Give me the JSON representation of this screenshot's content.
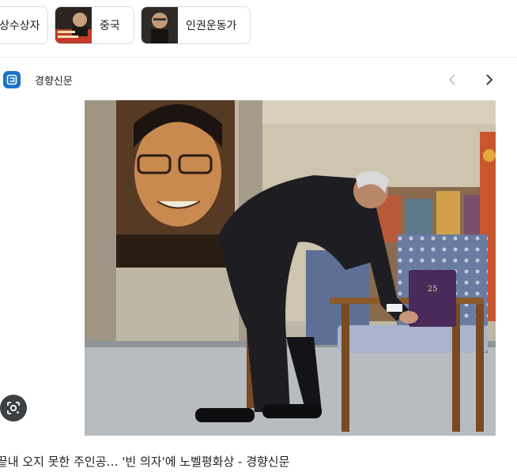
{
  "related_chips": [
    {
      "label": "상수상자"
    },
    {
      "label": "중국"
    },
    {
      "label": "인권운동가"
    }
  ],
  "source": {
    "name": "경향신문",
    "logo_color": "#1a73c8"
  },
  "nav": {
    "prev_icon": "chevron-left-icon",
    "next_icon": "chevron-right-icon"
  },
  "image": {
    "subject": "empty chair with Nobel medal box, large portrait in background"
  },
  "visual_search_icon": "lens-icon",
  "caption": "끝내 오지 못한 주인공… '빈 의자'에 노벨평화상 - 경향신문"
}
